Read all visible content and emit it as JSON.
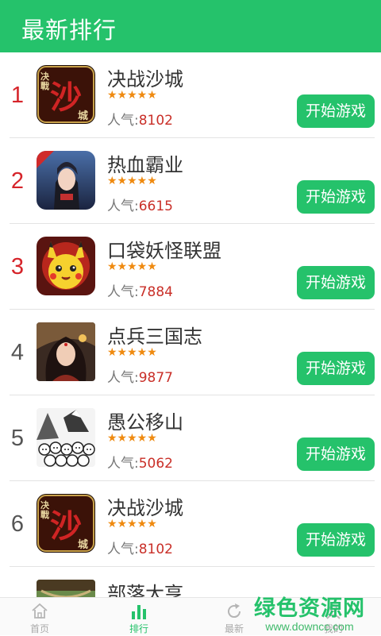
{
  "header": {
    "title": "最新排行"
  },
  "colors": {
    "accent": "#25c26b",
    "rank_top": "#d6242a",
    "popularity_number": "#c92f28",
    "stars": "#ef8a10"
  },
  "list": {
    "stars": "★★★★★",
    "popularity_prefix": "人气:",
    "items": [
      {
        "rank": "1",
        "name": "决战沙城",
        "popularity": "8102",
        "button": "开始游戏",
        "icon": "juezhan-shacheng-game-icon"
      },
      {
        "rank": "2",
        "name": "热血霸业",
        "popularity": "6615",
        "button": "开始游戏",
        "icon": "rexue-baye-game-icon",
        "icon_badge": "H5"
      },
      {
        "rank": "3",
        "name": "口袋妖怪联盟",
        "popularity": "7884",
        "button": "开始游戏",
        "icon": "pikachu-game-icon"
      },
      {
        "rank": "4",
        "name": "点兵三国志",
        "popularity": "9877",
        "button": "开始游戏",
        "icon": "dianbing-sanguozhi-game-icon"
      },
      {
        "rank": "5",
        "name": "愚公移山",
        "popularity": "5062",
        "button": "开始游戏",
        "icon": "yugong-yishan-game-icon"
      },
      {
        "rank": "6",
        "name": "决战沙城",
        "popularity": "8102",
        "button": "开始游戏",
        "icon": "juezhan-shacheng-game-icon"
      },
      {
        "rank": "",
        "name": "部落大亨",
        "popularity": "",
        "button": "",
        "icon": "buluo-daheng-game-icon"
      }
    ]
  },
  "tabbar": {
    "tabs": [
      {
        "label": "首页",
        "icon": "home-icon",
        "active": false
      },
      {
        "label": "排行",
        "icon": "bar-chart-icon",
        "active": true
      },
      {
        "label": "最新",
        "icon": "refresh-icon",
        "active": false
      },
      {
        "label": "我的",
        "icon": "user-icon",
        "active": false
      }
    ]
  },
  "watermark": {
    "main": "绿色资源网",
    "sub": "www.downcc.com"
  }
}
